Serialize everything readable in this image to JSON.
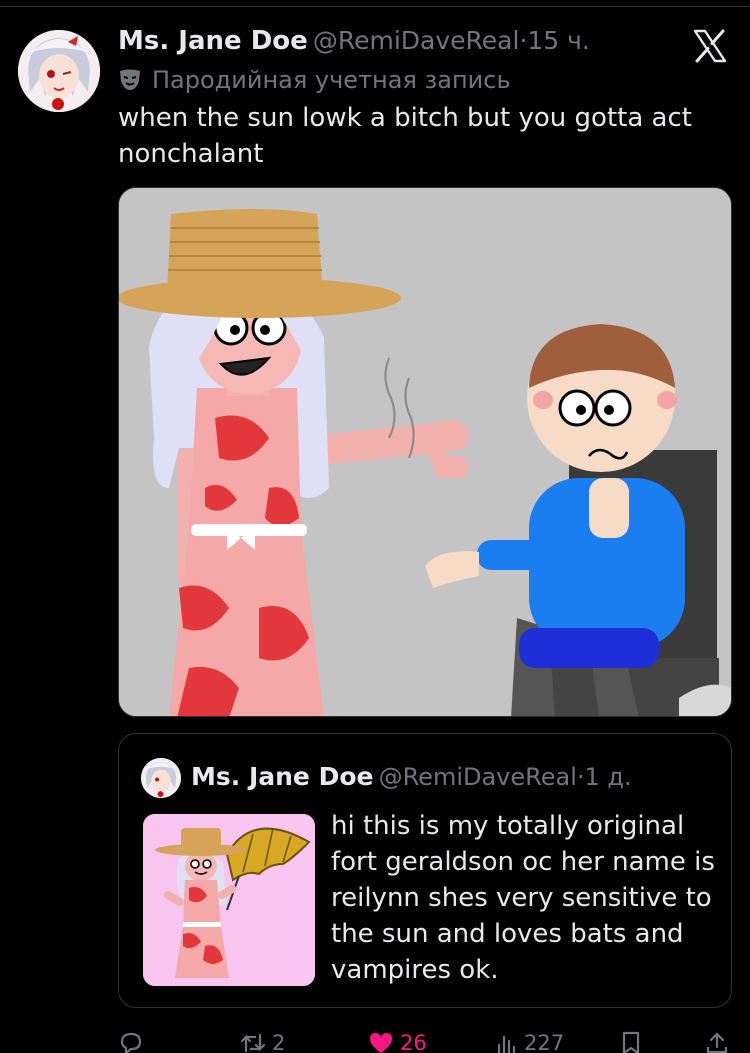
{
  "tweet": {
    "author_name": "Ms. Jane Doe",
    "author_handle": "@RemiDaveReal",
    "separator": "·",
    "time": "15 ч.",
    "parody_label": "Пародийная учетная запись",
    "text": "when the sun lowk a bitch but you gotta act nonchalant",
    "avatar_icon": "avatar-icon",
    "platform_icon": "x-logo-icon"
  },
  "quoted_tweet": {
    "author_name": "Ms. Jane Doe",
    "author_handle": "@RemiDaveReal",
    "separator": "·",
    "time": "1 д.",
    "text": "hi this is my totally original fort geraldson oc her name is reilynn shes very sensitive to the sun and loves bats and vampires ok."
  },
  "actions": {
    "reply_count": "",
    "retweet_count": "2",
    "like_count": "26",
    "views_count": "227",
    "like_color": "#f91880"
  },
  "colors": {
    "background": "#000000",
    "text_primary": "#e7e9ea",
    "text_secondary": "#71767b",
    "border": "#2f3336"
  }
}
